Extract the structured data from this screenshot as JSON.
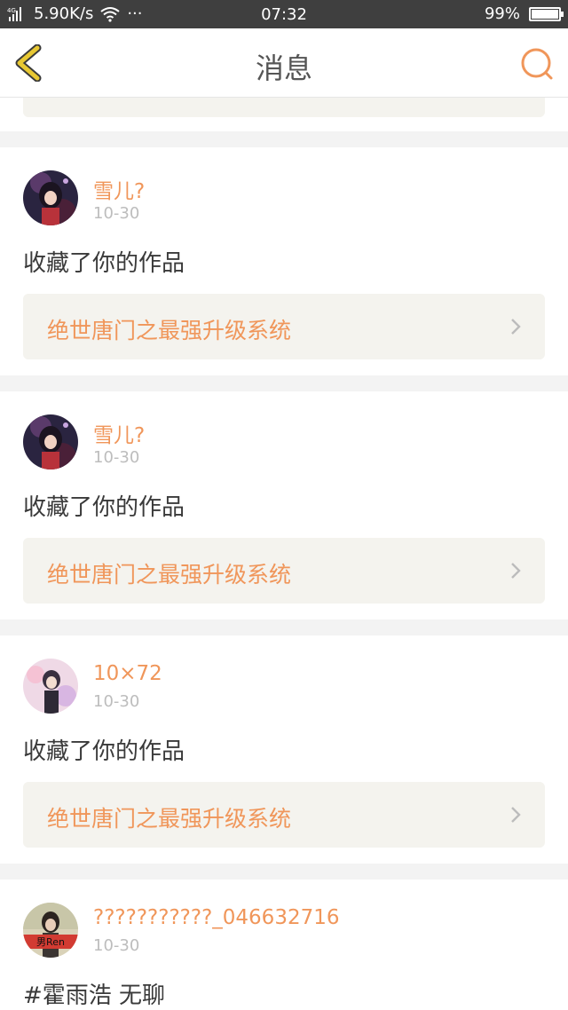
{
  "status_bar": {
    "network": "5.90K/s",
    "dots": "···",
    "time": "07:32",
    "battery": "99%",
    "battery_level": 0.99
  },
  "header": {
    "title": "消息",
    "back_icon": "back-chevron-icon",
    "search_icon": "search-icon"
  },
  "messages": [
    {
      "user": "雪儿?",
      "date": "10-30",
      "action": "收藏了你的作品",
      "work": "绝世唐门之最强升级系统"
    },
    {
      "user": "雪儿?",
      "date": "10-30",
      "action": "收藏了你的作品",
      "work": "绝世唐门之最强升级系统"
    },
    {
      "user": "10×72",
      "date": "10-30",
      "action": "收藏了你的作品",
      "work": "绝世唐门之最强升级系统"
    },
    {
      "user": "???????????_046632716",
      "date": "10-30",
      "action": "#霍雨浩 无聊",
      "avatar_caption": "男Ren"
    }
  ],
  "colors": {
    "accent": "#f0965a",
    "status_bg": "#3f3f3f",
    "back_icon": "#e8c833"
  }
}
